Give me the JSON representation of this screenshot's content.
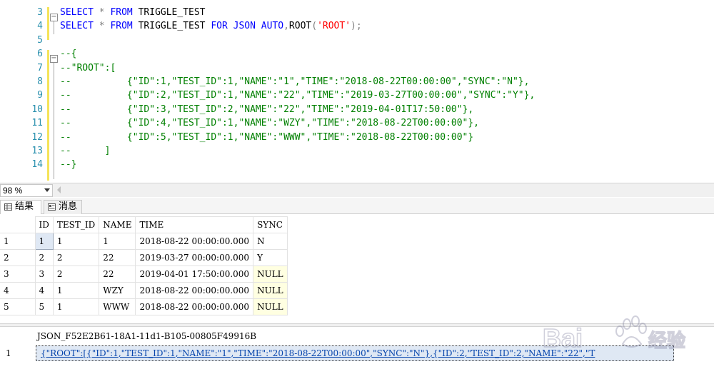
{
  "editor": {
    "line_numbers": [
      "3",
      "4",
      "5",
      "6",
      "7",
      "8",
      "9",
      "10",
      "11",
      "12",
      "13",
      "14"
    ],
    "lines": [
      {
        "parts": [
          {
            "t": "SELECT ",
            "c": "kw"
          },
          {
            "t": "* ",
            "c": "op"
          },
          {
            "t": "FROM ",
            "c": "kw"
          },
          {
            "t": "TRIGGLE_TEST",
            "c": ""
          }
        ]
      },
      {
        "parts": [
          {
            "t": "SELECT ",
            "c": "kw"
          },
          {
            "t": "* ",
            "c": "op"
          },
          {
            "t": "FROM ",
            "c": "kw"
          },
          {
            "t": "TRIGGLE_TEST ",
            "c": ""
          },
          {
            "t": "FOR JSON AUTO",
            "c": "kw"
          },
          {
            "t": ",",
            "c": "op"
          },
          {
            "t": "ROOT",
            "c": ""
          },
          {
            "t": "(",
            "c": "op"
          },
          {
            "t": "'ROOT'",
            "c": "str"
          },
          {
            "t": ");",
            "c": "op"
          }
        ]
      },
      {
        "parts": []
      },
      {
        "parts": [
          {
            "t": "--{",
            "c": "cm"
          }
        ]
      },
      {
        "parts": [
          {
            "t": "--\"ROOT\":[",
            "c": "cm"
          }
        ]
      },
      {
        "parts": [
          {
            "t": "--          {\"ID\":1,\"TEST_ID\":1,\"NAME\":\"1\",\"TIME\":\"2018-08-22T00:00:00\",\"SYNC\":\"N\"},",
            "c": "cm"
          }
        ]
      },
      {
        "parts": [
          {
            "t": "--          {\"ID\":2,\"TEST_ID\":1,\"NAME\":\"22\",\"TIME\":\"2019-03-27T00:00:00\",\"SYNC\":\"Y\"},",
            "c": "cm"
          }
        ]
      },
      {
        "parts": [
          {
            "t": "--          {\"ID\":3,\"TEST_ID\":2,\"NAME\":\"22\",\"TIME\":\"2019-04-01T17:50:00\"},",
            "c": "cm"
          }
        ]
      },
      {
        "parts": [
          {
            "t": "--          {\"ID\":4,\"TEST_ID\":1,\"NAME\":\"WZY\",\"TIME\":\"2018-08-22T00:00:00\"},",
            "c": "cm"
          }
        ]
      },
      {
        "parts": [
          {
            "t": "--          {\"ID\":5,\"TEST_ID\":1,\"NAME\":\"WWW\",\"TIME\":\"2018-08-22T00:00:00\"}",
            "c": "cm"
          }
        ]
      },
      {
        "parts": [
          {
            "t": "--      ]",
            "c": "cm"
          }
        ]
      },
      {
        "parts": [
          {
            "t": "--}",
            "c": "cm"
          }
        ]
      }
    ]
  },
  "zoom": {
    "value": "98 %"
  },
  "tabs": {
    "results": "结果",
    "messages": "消息"
  },
  "grid1": {
    "columns": [
      "ID",
      "TEST_ID",
      "NAME",
      "TIME",
      "SYNC"
    ],
    "rows": [
      {
        "num": "1",
        "cells": [
          "1",
          "1",
          "1",
          "2018-08-22 00:00:00.000",
          "N"
        ]
      },
      {
        "num": "2",
        "cells": [
          "2",
          "2",
          "22",
          "2019-03-27 00:00:00.000",
          "Y"
        ]
      },
      {
        "num": "3",
        "cells": [
          "3",
          "2",
          "22",
          "2019-04-01 17:50:00.000",
          "NULL"
        ]
      },
      {
        "num": "4",
        "cells": [
          "4",
          "1",
          "WZY",
          "2018-08-22 00:00:00.000",
          "NULL"
        ]
      },
      {
        "num": "5",
        "cells": [
          "5",
          "1",
          "WWW",
          "2018-08-22 00:00:00.000",
          "NULL"
        ]
      }
    ]
  },
  "grid2": {
    "column": "JSON_F52E2B61-18A1-11d1-B105-00805F49916B",
    "row_num": "1",
    "value": "{\"ROOT\":[{\"ID\":1,\"TEST_ID\":1,\"NAME\":\"1\",\"TIME\":\"2018-08-22T00:00:00\",\"SYNC\":\"N\"},{\"ID\":2,\"TEST_ID\":2,\"NAME\":\"22\",\"T"
  },
  "watermark": {
    "text": "Bai",
    "text2": "du",
    "text3": "经验"
  },
  "colors": {
    "keyword": "#0000ff",
    "comment": "#008000",
    "string": "#ff0000",
    "null_cell": "#ffffe1",
    "line_number": "#2b91af"
  }
}
